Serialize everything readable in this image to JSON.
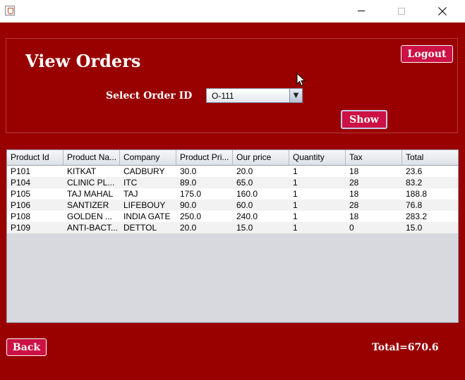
{
  "window": {
    "minimize_glyph": "",
    "close_glyph": "✕"
  },
  "header": {
    "title": "View Orders",
    "logout_label": "Logout",
    "select_label": "Select Order ID",
    "order_id_value": "O-111",
    "show_label": "Show"
  },
  "table": {
    "columns": [
      "Product Id",
      "Product Na...",
      "Company",
      "Product Pri...",
      "Our price",
      "Quantity",
      "Tax",
      "Total"
    ],
    "rows": [
      [
        "P101",
        "KITKAT",
        "CADBURY",
        "30.0",
        "20.0",
        "1",
        "18",
        "23.6"
      ],
      [
        "P104",
        "CLINIC PL...",
        "ITC",
        "89.0",
        "65.0",
        "1",
        "28",
        "83.2"
      ],
      [
        "P105",
        "TAJ MAHAL",
        "TAJ",
        "175.0",
        "160.0",
        "1",
        "18",
        "188.8"
      ],
      [
        "P106",
        "SANTIZER",
        "LIFEBOUY",
        "90.0",
        "60.0",
        "1",
        "28",
        "76.8"
      ],
      [
        "P108",
        "GOLDEN ...",
        "INDIA GATE",
        "250.0",
        "240.0",
        "1",
        "18",
        "283.2"
      ],
      [
        "P109",
        "ANTI-BACT...",
        "DETTOL",
        "20.0",
        "15.0",
        "1",
        "0",
        "15.0"
      ]
    ]
  },
  "footer": {
    "back_label": "Back",
    "total_text": "Total=670.6"
  },
  "colors": {
    "background": "#990000",
    "button": "#cc1144"
  }
}
